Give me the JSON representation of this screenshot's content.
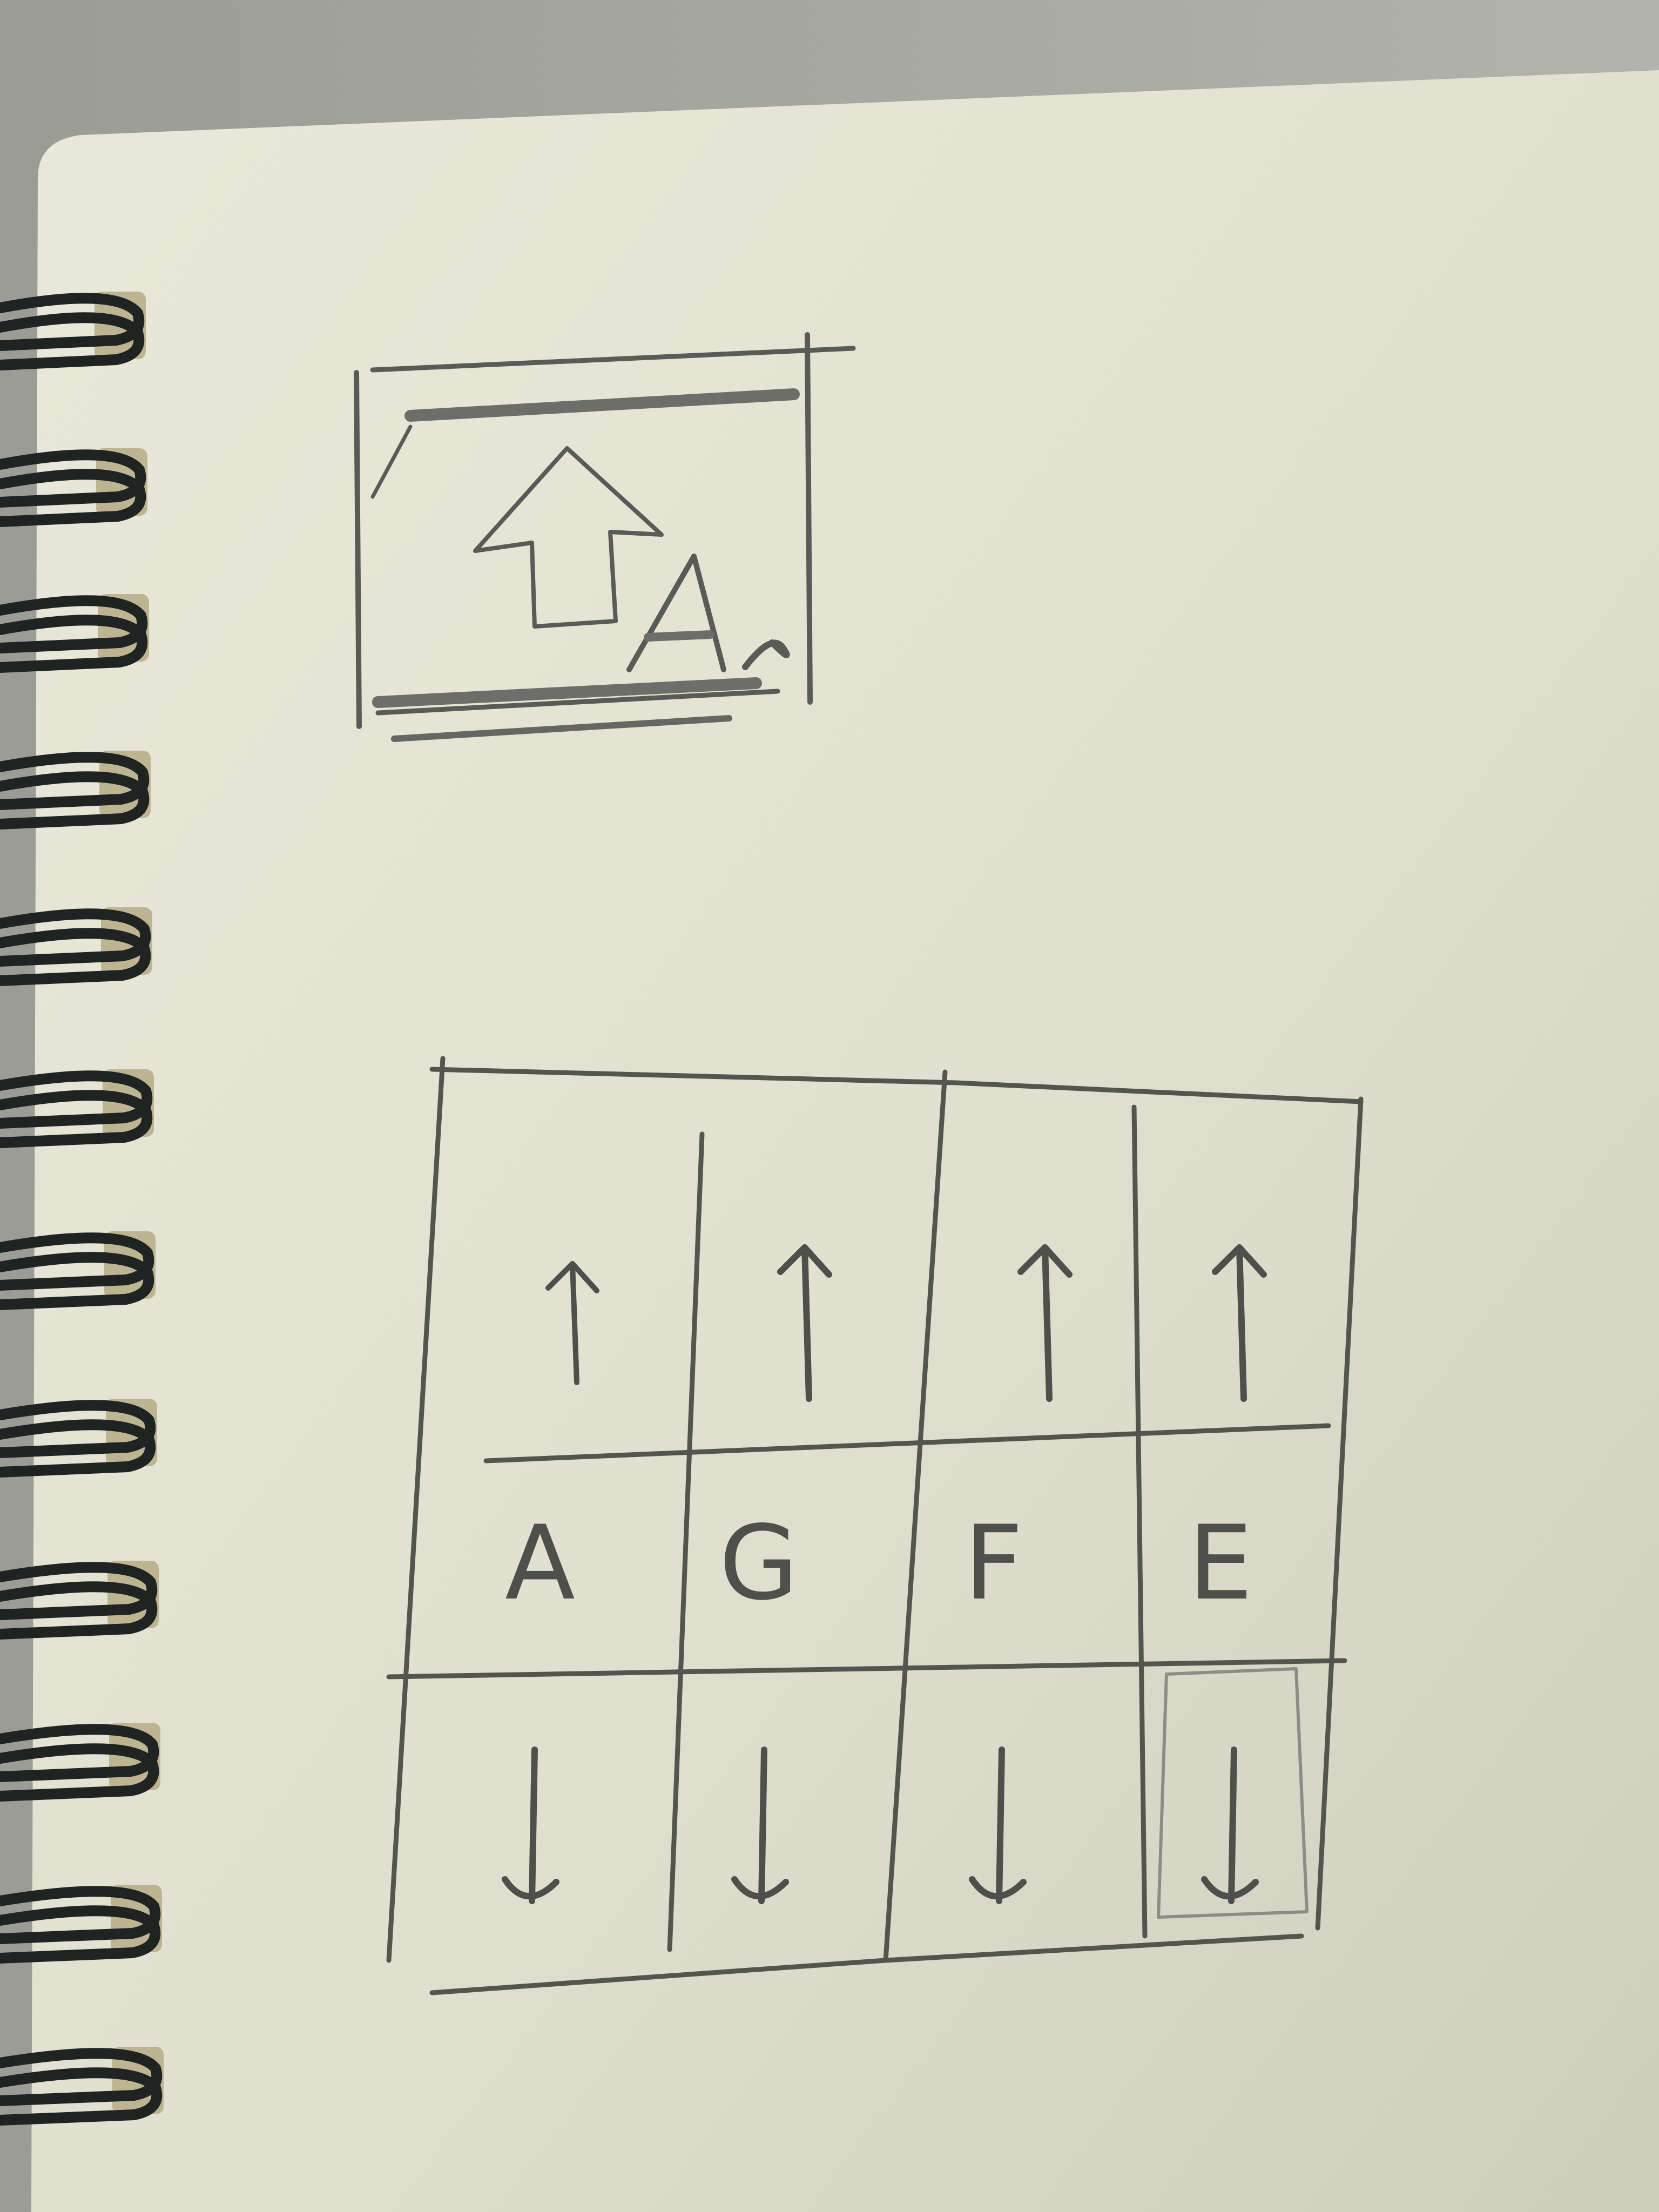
{
  "photo": {
    "colors": {
      "table": "#a9a9a3",
      "paper": "#e6e5d6",
      "pencil": "#4f4f4c",
      "spiral_wire": "#1f2321",
      "ring_holder": "#bdb592"
    }
  },
  "sketch_icon": {
    "icon_name": "upload-image-icon",
    "letter": "A"
  },
  "sketch_grid": {
    "rows": [
      {
        "cells": [
          "up-arrow-icon",
          "up-arrow-icon",
          "up-arrow-icon",
          "up-arrow-icon"
        ]
      },
      {
        "cells": [
          "A",
          "G",
          "F",
          "E"
        ]
      },
      {
        "cells": [
          "down-arrow-icon",
          "down-arrow-icon",
          "down-arrow-icon",
          "down-arrow-icon"
        ]
      }
    ],
    "highlighted": {
      "row": 2,
      "col": 3
    }
  }
}
